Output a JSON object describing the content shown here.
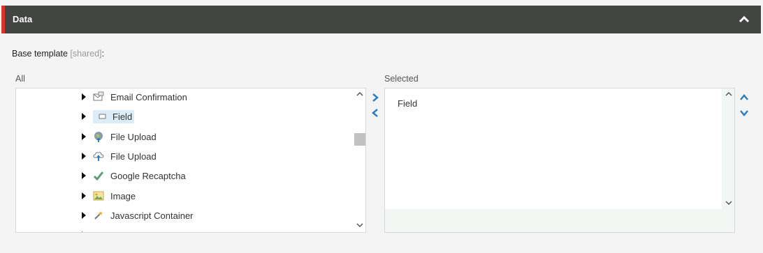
{
  "panel": {
    "title": "Data"
  },
  "base_template": {
    "label": "Base template",
    "shared": "[shared]",
    "colon": ":"
  },
  "all_list": {
    "heading": "All",
    "items": [
      {
        "label": "Email Confirmation",
        "icon": "email-confirmation-icon"
      },
      {
        "label": "Field",
        "icon": "field-icon",
        "selected": true
      },
      {
        "label": "File Upload",
        "icon": "globe-upload-icon"
      },
      {
        "label": "File Upload",
        "icon": "cloud-upload-icon"
      },
      {
        "label": "Google Recaptcha",
        "icon": "checkmark-icon"
      },
      {
        "label": "Image",
        "icon": "image-icon"
      },
      {
        "label": "Javascript Container",
        "icon": "wand-icon"
      }
    ]
  },
  "selected_list": {
    "heading": "Selected",
    "items": [
      "Field"
    ]
  },
  "colors": {
    "header_bg": "#424542",
    "accent": "#d8352a",
    "selection": "#dcedf7",
    "arrow_blue": "#2f7ec0"
  }
}
